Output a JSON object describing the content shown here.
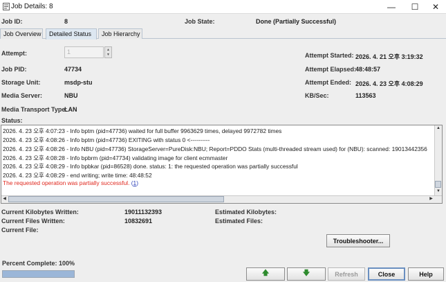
{
  "window": {
    "title": "Job Details: 8"
  },
  "header": {
    "job_id_label": "Job ID:",
    "job_id_value": "8",
    "job_state_label": "Job State:",
    "job_state_value": "Done (Partially Successful)"
  },
  "tabs": [
    {
      "label": "Job Overview"
    },
    {
      "label": "Detailed Status"
    },
    {
      "label": "Job Hierarchy"
    }
  ],
  "details": {
    "attempt_label": "Attempt:",
    "attempt_value": "1",
    "job_pid_label": "Job PID:",
    "job_pid_value": "47734",
    "storage_unit_label": "Storage Unit:",
    "storage_unit_value": "msdp-stu",
    "media_server_label": "Media Server:",
    "media_server_value": "NBU",
    "transport_label": "Media Transport Type:",
    "transport_value": "LAN",
    "attempt_started_label": "Attempt Started:",
    "attempt_started_value": "2026. 4. 21 오후 3:19:32",
    "attempt_elapsed_label": "Attempt Elapsed:",
    "attempt_elapsed_value": "48:48:57",
    "attempt_ended_label": "Attempt Ended:",
    "attempt_ended_value": "2026. 4. 23 오후 4:08:29",
    "kbsec_label": "KB/Sec:",
    "kbsec_value": "113563"
  },
  "status": {
    "label": "Status:",
    "lines": [
      "2026. 4. 23 오후 4:07:23 - Info bptm (pid=47736) waited for full buffer 9963629 times, delayed 9972782 times",
      "2026. 4. 23 오후 4:08:26 - Info bptm (pid=47736) EXITING with status 0 <----------",
      "2026. 4. 23 오후 4:08:26 - Info NBU (pid=47736) StorageServer=PureDisk:NBU; Report=PDDO Stats (multi-threaded stream used) for (NBU): scanned: 19013442356",
      "2026. 4. 23 오후 4:08:28 - Info bpbrm (pid=47734) validating image for client ecmmaster",
      "2026. 4. 23 오후 4:08:29 - Info bpbkar (pid=86528) done. status: 1: the requested operation was partially successful",
      "2026. 4. 23 오후 4:08:29 - end writing; write time: 48:48:52"
    ],
    "result_text": "The requested operation was partially successful.",
    "result_link_pre": "(",
    "result_link": "1",
    "result_link_post": ")"
  },
  "summary": {
    "kb_written_label": "Current Kilobytes Written:",
    "kb_written_value": "19011132393",
    "files_written_label": "Current Files Written:",
    "files_written_value": "10832691",
    "current_file_label": "Current File:",
    "est_kb_label": "Estimated Kilobytes:",
    "est_files_label": "Estimated Files:"
  },
  "buttons": {
    "troubleshooter": "Troubleshooter...",
    "refresh": "Refresh",
    "close": "Close",
    "help": "Help"
  },
  "progress": {
    "label": "Percent Complete: 100%",
    "fraction": 1.0
  },
  "icons": [
    "app-icon",
    "minimize-icon",
    "maximize-icon",
    "close-icon",
    "arrow-up-icon",
    "arrow-down-icon"
  ]
}
